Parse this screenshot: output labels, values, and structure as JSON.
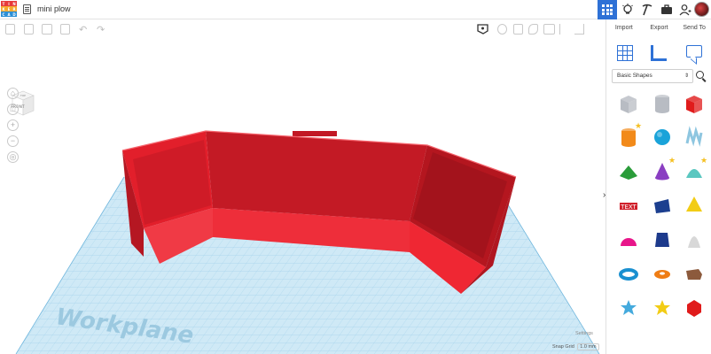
{
  "app": {
    "logo_letters": [
      "T",
      "I",
      "N",
      "K",
      "E",
      "R",
      "C",
      "A",
      "D"
    ],
    "logo_colors": [
      "#e73a3a",
      "#e73a3a",
      "#e73a3a",
      "#f4a92d",
      "#f4a92d",
      "#f4a92d",
      "#2b8fd6",
      "#2b8fd6",
      "#2b8fd6"
    ],
    "design_title": "mini plow",
    "accent_color": "#2e71d6"
  },
  "top_actions": {
    "grid_view_icon": "grid-icon",
    "lightbulb_icon": "lightbulb-icon",
    "pickaxe_icon": "pickaxe-icon",
    "briefcase_icon": "briefcase-icon",
    "user_icon": "add-user-icon"
  },
  "toolbar": {
    "tools": [
      "new-shape-icon",
      "paste-icon",
      "duplicate-icon",
      "delete-icon",
      "undo-icon",
      "redo-icon"
    ],
    "right_tools": [
      "note-icon",
      "bulb-icon",
      "group-icon",
      "ungroup-icon",
      "align-icon",
      "mirror-icon",
      "flip-icon"
    ]
  },
  "panel": {
    "import_label": "Import",
    "export_label": "Export",
    "send_label": "Send To",
    "shape_library": "Basic Shapes",
    "shapes": [
      {
        "name": "box-hole",
        "color": "#b8bcc3"
      },
      {
        "name": "cylinder-hole",
        "color": "#b8bcc3"
      },
      {
        "name": "box",
        "color": "#e01b1b"
      },
      {
        "name": "cylinder",
        "color": "#f28a1a"
      },
      {
        "name": "sphere",
        "color": "#1aa3d9"
      },
      {
        "name": "scribble",
        "color": "#8ec6e0"
      },
      {
        "name": "roof",
        "color": "#2a9c3a"
      },
      {
        "name": "cone",
        "color": "#8a3ec2"
      },
      {
        "name": "round-roof",
        "color": "#5bc7c0"
      },
      {
        "name": "text",
        "color": "#d01f2a"
      },
      {
        "name": "half-cube",
        "color": "#1c3f8f"
      },
      {
        "name": "pyramid",
        "color": "#f2cc15"
      },
      {
        "name": "half-sphere",
        "color": "#e8168a"
      },
      {
        "name": "polygon",
        "color": "#1d3a8c"
      },
      {
        "name": "paraboloid",
        "color": "#d8d8d8"
      },
      {
        "name": "torus",
        "color": "#1a90d0"
      },
      {
        "name": "tube",
        "color": "#ef7d15"
      },
      {
        "name": "shape-generator",
        "color": "#8c5a3c"
      },
      {
        "name": "star",
        "color": "#44aadd"
      },
      {
        "name": "star-gold",
        "color": "#f2cc15"
      },
      {
        "name": "icosahedron",
        "color": "#e01b1b"
      }
    ]
  },
  "viewcube": {
    "top": "TOP",
    "front": "FRONT"
  },
  "workplane": {
    "label": "Workplane",
    "settings_label": "Settings",
    "snap_label": "Snap Grid",
    "snap_value": "1.0 mm"
  },
  "model": {
    "color": "#e0232e"
  }
}
